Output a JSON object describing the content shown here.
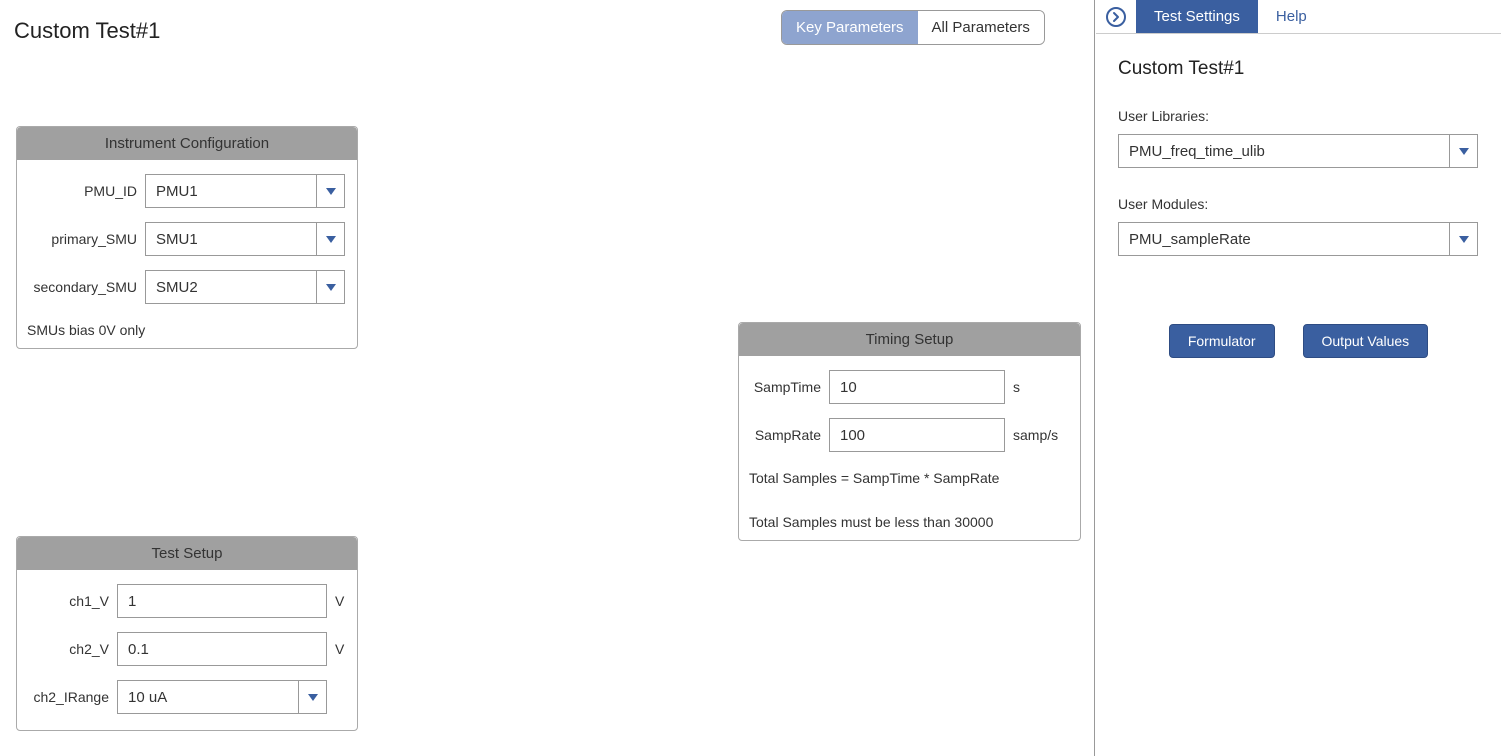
{
  "title": "Custom Test#1",
  "param_tabs": {
    "key": "Key Parameters",
    "all": "All Parameters"
  },
  "instrument_config": {
    "header": "Instrument Configuration",
    "pmu_id": {
      "label": "PMU_ID",
      "value": "PMU1"
    },
    "primary_smu": {
      "label": "primary_SMU",
      "value": "SMU1"
    },
    "secondary_smu": {
      "label": "secondary_SMU",
      "value": "SMU2"
    },
    "note": "SMUs bias 0V only"
  },
  "test_setup": {
    "header": "Test Setup",
    "ch1_v": {
      "label": "ch1_V",
      "value": "1",
      "unit": "V"
    },
    "ch2_v": {
      "label": "ch2_V",
      "value": "0.1",
      "unit": "V"
    },
    "ch2_irange": {
      "label": "ch2_IRange",
      "value": "10 uA"
    }
  },
  "timing_setup": {
    "header": "Timing Setup",
    "samp_time": {
      "label": "SampTime",
      "value": "10",
      "unit": "s"
    },
    "samp_rate": {
      "label": "SampRate",
      "value": "100",
      "unit": "samp/s"
    },
    "note1": "Total Samples = SampTime * SampRate",
    "note2": "Total Samples must be less than 30000"
  },
  "sidebar": {
    "tabs": {
      "settings": "Test Settings",
      "help": "Help"
    },
    "title": "Custom Test#1",
    "user_libraries": {
      "label": "User Libraries:",
      "value": "PMU_freq_time_ulib"
    },
    "user_modules": {
      "label": "User Modules:",
      "value": "PMU_sampleRate"
    },
    "buttons": {
      "formulator": "Formulator",
      "output_values": "Output Values"
    }
  }
}
